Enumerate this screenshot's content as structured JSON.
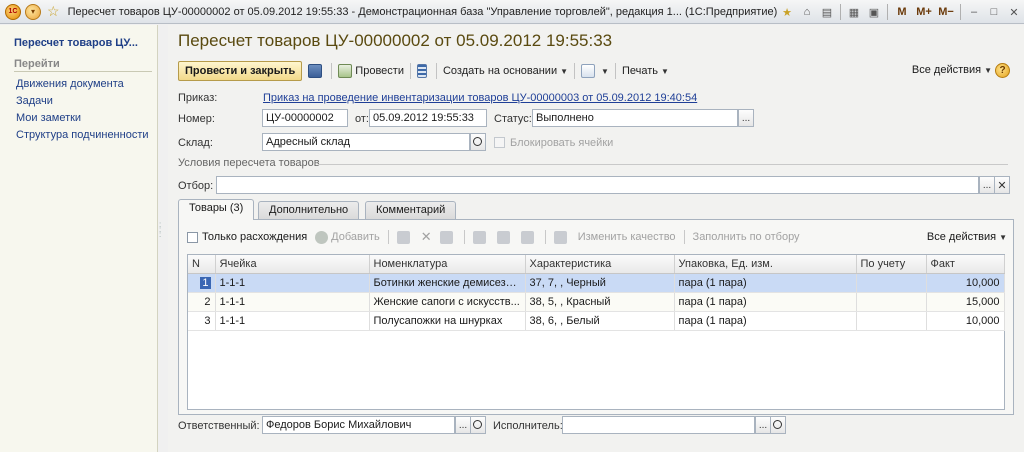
{
  "window": {
    "logo": "1С",
    "title": "Пересчет товаров ЦУ-00000002 от 05.09.2012 19:55:33 - Демонстрационная база \"Управление торговлей\", редакция 1... (1С:Предприятие)",
    "tools": [
      "M",
      "M+",
      "M−"
    ]
  },
  "nav": {
    "title": "Пересчет товаров ЦУ...",
    "section": "Перейти",
    "items": [
      "Движения документа",
      "Задачи",
      "Мои заметки",
      "Структура подчиненности"
    ]
  },
  "doc": {
    "title": "Пересчет товаров ЦУ-00000002 от 05.09.2012 19:55:33"
  },
  "toolbar": {
    "post_close": "Провести и закрыть",
    "post": "Провести",
    "based_on": "Создать на основании",
    "print": "Печать",
    "all_actions": "Все действия",
    "help": "?"
  },
  "form": {
    "order_label": "Приказ:",
    "order_link": "Приказ на проведение инвентаризации товаров ЦУ-00000003 от 05.09.2012 19:40:54",
    "number_label": "Номер:",
    "number_value": "ЦУ-00000002",
    "from_label": "от:",
    "date_value": "05.09.2012 19:55:33",
    "status_label": "Статус:",
    "status_value": "Выполнено",
    "warehouse_label": "Склад:",
    "warehouse_value": "Адресный склад",
    "block_cells_label": "Блокировать ячейки",
    "conditions_label": "Условия пересчета товаров",
    "filter_label": "Отбор:",
    "filter_value": "",
    "ellipsis": "..."
  },
  "tabs": [
    {
      "label": "Товары (3)",
      "active": true
    },
    {
      "label": "Дополнительно",
      "active": false
    },
    {
      "label": "Комментарий",
      "active": false
    }
  ],
  "items_toolbar": {
    "only_diff": "Только расхождения",
    "add": "Добавить",
    "change_quality": "Изменить качество",
    "fill_by_filter": "Заполнить по отбору",
    "all_actions": "Все действия"
  },
  "table": {
    "columns": [
      "N",
      "Ячейка",
      "Номенклатура",
      "Характеристика",
      "Упаковка, Ед. изм.",
      "По учету",
      "Факт"
    ],
    "rows": [
      {
        "n": "1",
        "cell": "1-1-1",
        "item": "Ботинки женские демисезо...",
        "char": "37, 7, , Черный",
        "pack": "пара (1 пара)",
        "account": "",
        "fact": "10,000"
      },
      {
        "n": "2",
        "cell": "1-1-1",
        "item": "Женские сапоги с искусств...",
        "char": "38, 5, , Красный",
        "pack": "пара (1 пара)",
        "account": "",
        "fact": "15,000"
      },
      {
        "n": "3",
        "cell": "1-1-1",
        "item": "Полусапожки на шнурках",
        "char": "38, 6, , Белый",
        "pack": "пара (1 пара)",
        "account": "",
        "fact": "10,000"
      }
    ]
  },
  "footer": {
    "responsible_label": "Ответственный:",
    "responsible_value": "Федоров Борис Михайлович",
    "executor_label": "Исполнитель:",
    "executor_value": ""
  },
  "colors": {
    "title_text": "#5a4a10",
    "link": "#1f3f97",
    "selection": "#c9daf5",
    "primary_button": "#f2d98a"
  }
}
